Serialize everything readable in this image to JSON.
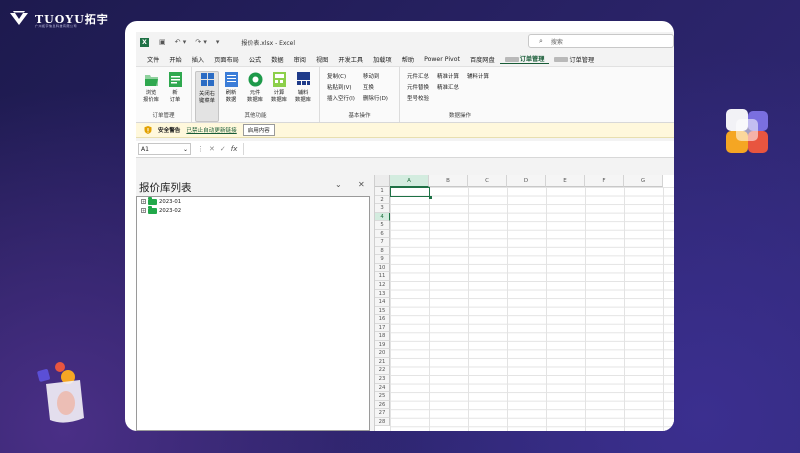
{
  "brand": {
    "name": "TUOYU拓宇",
    "tagline": "广州拓宇信息科技有限公司"
  },
  "app": {
    "doc_title": "报价表.xlsx  -  Excel",
    "search_placeholder": "搜索"
  },
  "menu": [
    "文件",
    "开始",
    "插入",
    "页面布局",
    "公式",
    "数据",
    "审阅",
    "视图",
    "开发工具",
    "加载项",
    "帮助",
    "Power Pivot",
    "百度网盘"
  ],
  "menu_active": "订单管理",
  "menu_last": "订单管理",
  "ribbon": {
    "order": {
      "label": "订单管理",
      "btns": [
        "浏览\n报价库",
        "新\n订单"
      ]
    },
    "other": {
      "label": "其他功能",
      "btns": [
        "关闭右\n键菜单",
        "刷新\n数据",
        "元件\n数据库",
        "计算\n数据库",
        "辅料\n数据库"
      ]
    },
    "basic": {
      "label": "基本操作",
      "col1": [
        "复制(C)",
        "粘贴到(V)",
        "插入空行(I)"
      ],
      "col2": [
        "移动到",
        "互换",
        "删除行(D)"
      ]
    },
    "data": {
      "label": "数据操作",
      "col1": [
        "元件汇总",
        "元件替换",
        "型号校验"
      ],
      "col2": [
        "精准计算",
        "精准汇总"
      ],
      "col3": [
        "辅料计算"
      ]
    }
  },
  "security": {
    "title": "安全警告",
    "message": "已禁止自动更新链接",
    "button": "启用内容"
  },
  "formula": {
    "namebox": "A1",
    "fx": "fx"
  },
  "pane": {
    "title": "报价库列表",
    "items": [
      "2023-01",
      "2023-02"
    ]
  },
  "sheet": {
    "columns": [
      "A",
      "B",
      "C",
      "D",
      "E",
      "F",
      "G"
    ],
    "rows": [
      "1",
      "2",
      "3",
      "4",
      "5",
      "6",
      "7",
      "8",
      "9",
      "10",
      "11",
      "12",
      "13",
      "14",
      "15",
      "16",
      "17",
      "18",
      "19",
      "20",
      "21",
      "22",
      "23",
      "24",
      "25",
      "26",
      "27",
      "28"
    ],
    "selected_row": "4",
    "active_col": "A"
  }
}
